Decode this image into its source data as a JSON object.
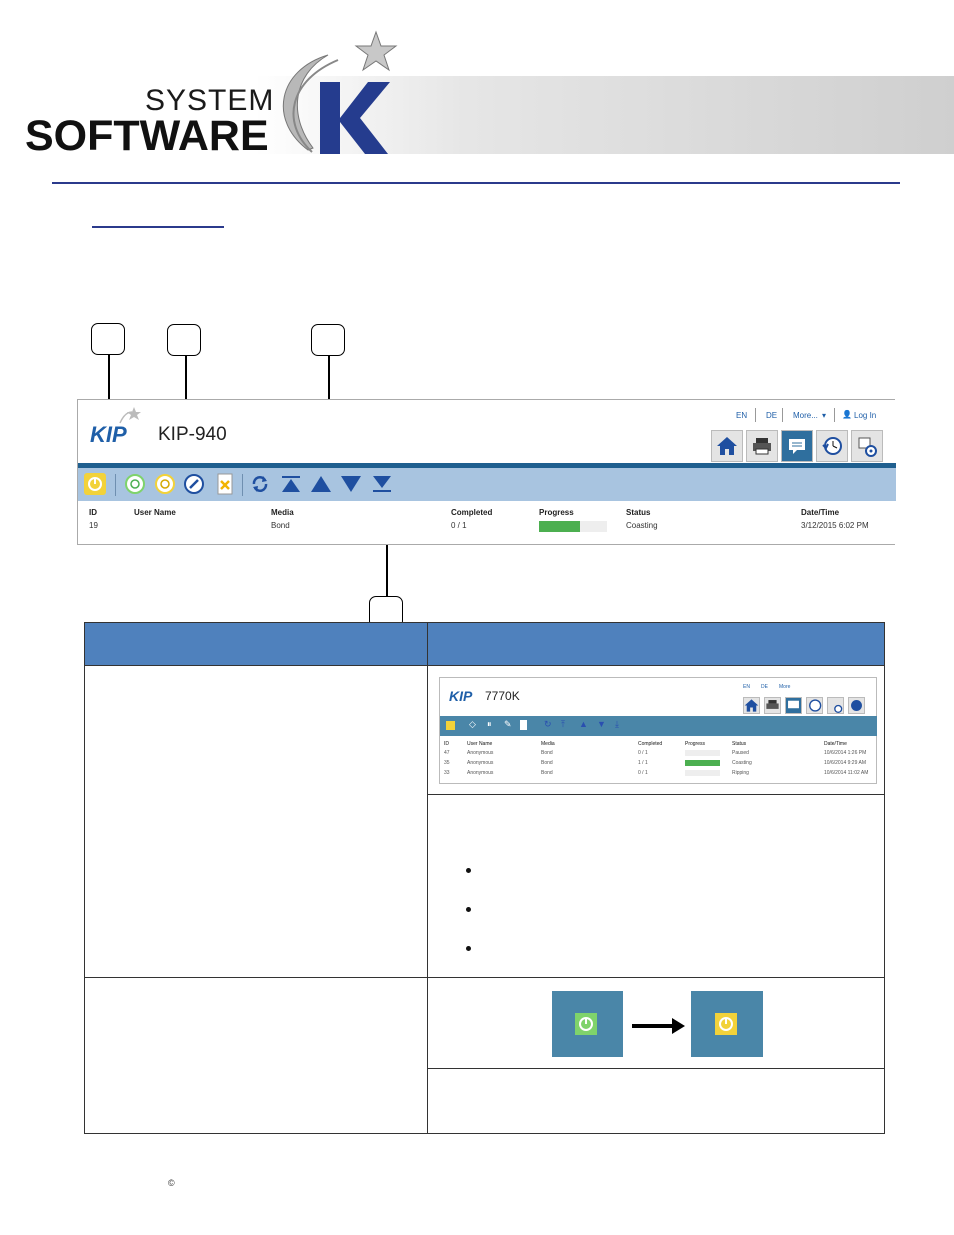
{
  "header": {
    "system_text": "SYSTEM",
    "software_text": "SOFTWARE"
  },
  "screenshot": {
    "logo": "KIP",
    "model": "KIP-940",
    "links": [
      "EN",
      "DE",
      "More...",
      "Log In"
    ],
    "columns": [
      "ID",
      "User Name",
      "Media",
      "Completed",
      "Progress",
      "Status",
      "Date/Time"
    ],
    "row": {
      "id": "19",
      "user": "",
      "media": "Bond",
      "completed": "0 / 1",
      "progress": 0.6,
      "status": "Coasting",
      "datetime": "3/12/2015 6:02 PM"
    }
  },
  "small_screenshot": {
    "logo": "KIP",
    "model": "7770K",
    "links": [
      "EN",
      "DE",
      "More"
    ],
    "columns": [
      "ID",
      "User Name",
      "Media",
      "Completed",
      "Progress",
      "Status",
      "Date/Time"
    ],
    "rows": [
      {
        "id": "47",
        "user": "Anonymous",
        "media": "Bond",
        "completed": "0 / 1",
        "progress": 0.0,
        "status": "Paused",
        "datetime": "10/6/2014 1:26 PM"
      },
      {
        "id": "35",
        "user": "Anonymous",
        "media": "Bond",
        "completed": "1 / 1",
        "progress": 1.0,
        "status": "Coasting",
        "datetime": "10/6/2014 9:29 AM"
      },
      {
        "id": "33",
        "user": "Anonymous",
        "media": "Bond",
        "completed": "0 / 1",
        "progress": 0.0,
        "status": "Ripping",
        "datetime": "10/6/2014 11:02 AM"
      }
    ]
  },
  "footer": {
    "copyright": "©"
  },
  "colors": {
    "accent": "#4f81bd",
    "toolbar": "#a8c4e0",
    "band": "#1f5f8f",
    "progress": "#4caf50",
    "pause_yellow": "#f2d23a",
    "resume_green": "#7fd36b"
  }
}
